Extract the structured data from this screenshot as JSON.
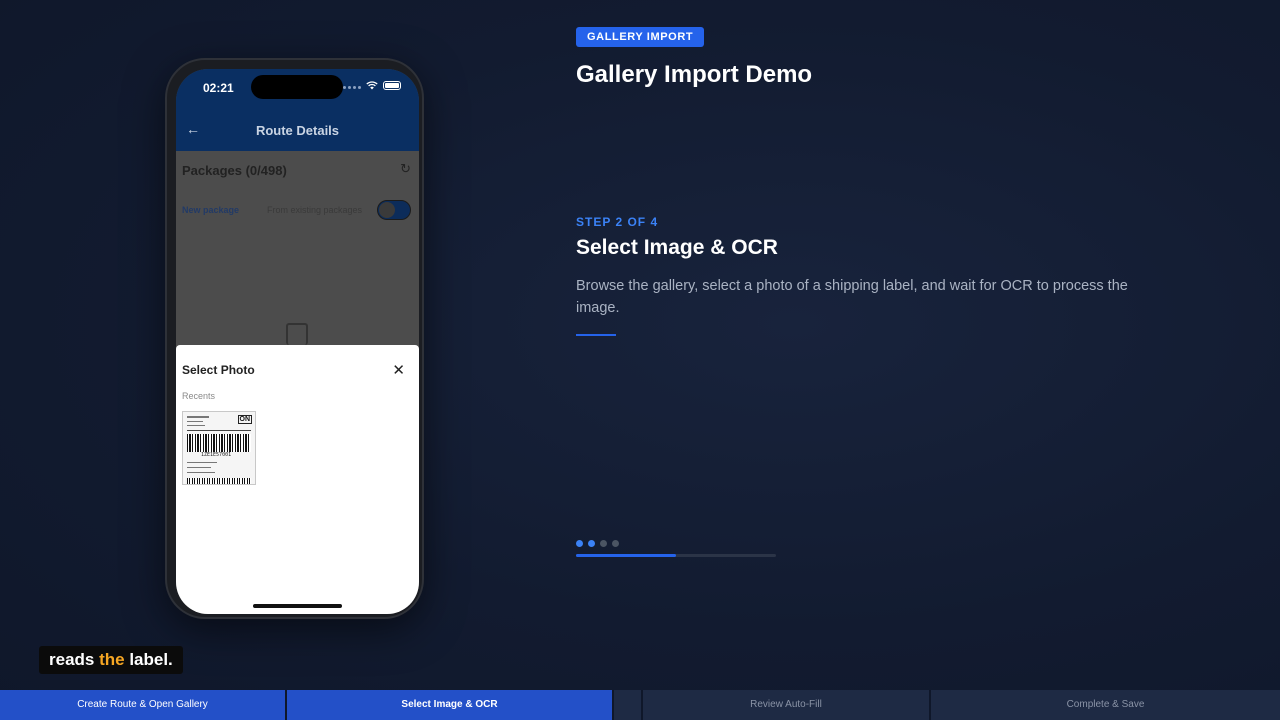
{
  "phone": {
    "time": "02:21",
    "nav_title": "Route Details",
    "packages_title": "Packages (0/498)",
    "new_package": "New package",
    "from_existing": "From existing packages",
    "sheet_title": "Select Photo",
    "recents": "Recents",
    "label_tag": "ON",
    "label_barcode_text": "1ZE1E57001"
  },
  "header": {
    "badge": "GALLERY IMPORT",
    "title": "Gallery Import Demo"
  },
  "step": {
    "label": "STEP 2 OF 4",
    "title": "Select Image & OCR",
    "description": "Browse the gallery, select a photo of a shipping label, and wait for OCR to process the image.",
    "current": 2,
    "total": 4,
    "progress_percent": 50
  },
  "caption": {
    "before": "reads ",
    "highlight": "the",
    "after": " label."
  },
  "tabs": [
    {
      "label": "Create Route & Open Gallery"
    },
    {
      "label": "Select Image & OCR"
    },
    {
      "label": "Review Auto-Fill"
    },
    {
      "label": "Complete & Save"
    }
  ],
  "colors": {
    "accent": "#2563eb",
    "highlight": "#f5a623",
    "dot_done": "#3b82f6",
    "dot_pending": "#4b5563"
  }
}
